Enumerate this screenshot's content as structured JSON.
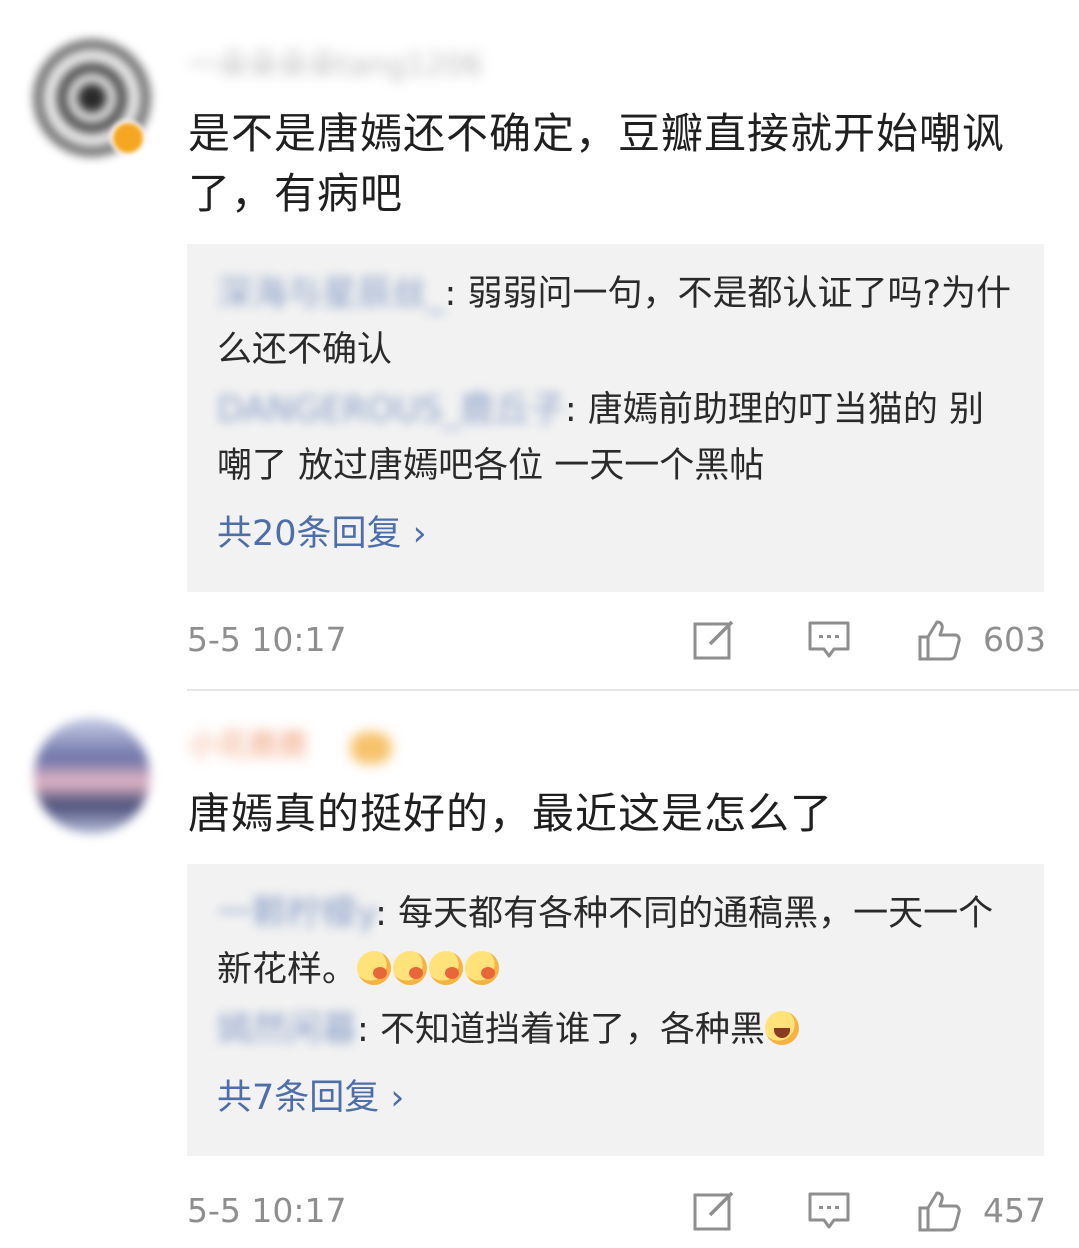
{
  "comments": [
    {
      "username": "一朵朵朵朵tang1206",
      "text": "是不是唐嫣还不确定，豆瓣直接就开始嘲讽了，有病吧",
      "replies": [
        {
          "user": "深海与星辰丝_",
          "colon": ": ",
          "text": "弱弱问一句，不是都认证了吗?为什么还不确认"
        },
        {
          "user": "DANGEROUS_鹿丘子",
          "colon": ": ",
          "text": "唐嫣前助理的叮当猫的 别嘲了 放过唐嫣吧各位 一天一个黑帖"
        }
      ],
      "more_replies": "共20条回复 ›",
      "timestamp": "5-5 10:17",
      "likes": "603"
    },
    {
      "username": "小花鹿鹿",
      "text": "唐嫣真的挺好的，最近这是怎么了",
      "replies": [
        {
          "user": "一颗柠檬y",
          "colon": ": ",
          "text": "每天都有各种不同的通稿黑，一天一个新花样。",
          "emoji": "smirk-emoji x4"
        },
        {
          "user": "嫣然闲暮",
          "colon": ": ",
          "text": "不知道挡着谁了，各种黑",
          "emoji": "laugh-cry-emoji"
        }
      ],
      "more_replies": "共7条回复 ›",
      "timestamp": "5-5 10:17",
      "likes": "457"
    }
  ],
  "colors": {
    "link_blue": "#4e6ea8",
    "meta_gray": "#8e8e8e",
    "reply_bg": "#f2f2f2",
    "vip_badge": "#f5a623"
  },
  "icons": [
    "edit-icon",
    "comment-icon",
    "like-icon"
  ]
}
